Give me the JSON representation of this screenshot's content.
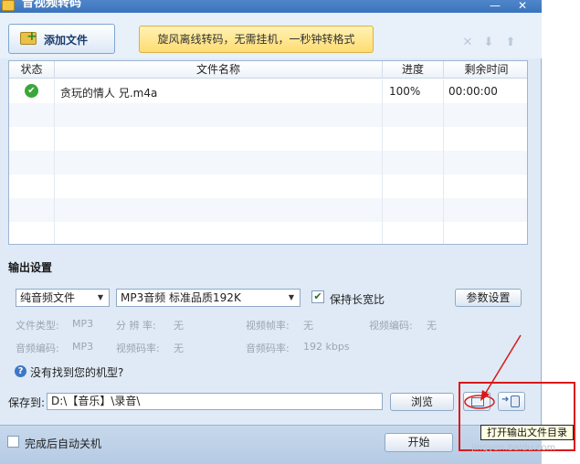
{
  "window": {
    "title": "音视频转码",
    "minimize_glyph": "—",
    "close_glyph": "✕"
  },
  "toolbar": {
    "add_file_label": "添加文件",
    "banner_text": "旋风离线转码，无需挂机，一秒钟转格式",
    "delete_glyph": "✕",
    "move_down_glyph": "⬇",
    "move_up_glyph": "⬆"
  },
  "file_table": {
    "headers": [
      "状态",
      "文件名称",
      "进度",
      "剩余时间"
    ],
    "rows": [
      {
        "status_icon": "success-check-icon",
        "status_glyph": "✔",
        "name": "贪玩的情人 兄.m4a",
        "progress": "100%",
        "remaining": "00:00:00"
      }
    ]
  },
  "output_settings": {
    "title": "输出设置",
    "format_category": "纯音频文件",
    "format_preset": "MP3音频 标准品质192K",
    "keep_ratio_label": "保持长宽比",
    "keep_ratio_checked": true,
    "params_button": "参数设置",
    "info": {
      "file_type_label": "文件类型:",
      "file_type_value": "MP3",
      "resolution_label": "分 辨 率:",
      "resolution_value": "无",
      "video_fps_label": "视频帧率:",
      "video_fps_value": "无",
      "video_codec_label": "视频编码:",
      "video_codec_value": "无",
      "audio_codec_label": "音频编码:",
      "audio_codec_value": "MP3",
      "video_bitrate_label": "视频码率:",
      "video_bitrate_value": "无",
      "audio_bitrate_label": "音频码率:",
      "audio_bitrate_value": "192 kbps"
    },
    "help_glyph": "?",
    "help_link": "没有找到您的机型?"
  },
  "save": {
    "label": "保存到:",
    "path": "D:\\【音乐】\\录音\\",
    "browse_button": "浏览"
  },
  "footer": {
    "auto_shutdown_label": "完成后自动关机",
    "start_button": "开始"
  },
  "tooltip": "打开输出文件目录",
  "watermark": "jingyan.baidu.com",
  "colors": {
    "accent": "#3b74bd",
    "annotation": "#d81919",
    "success": "#3aa63a"
  }
}
